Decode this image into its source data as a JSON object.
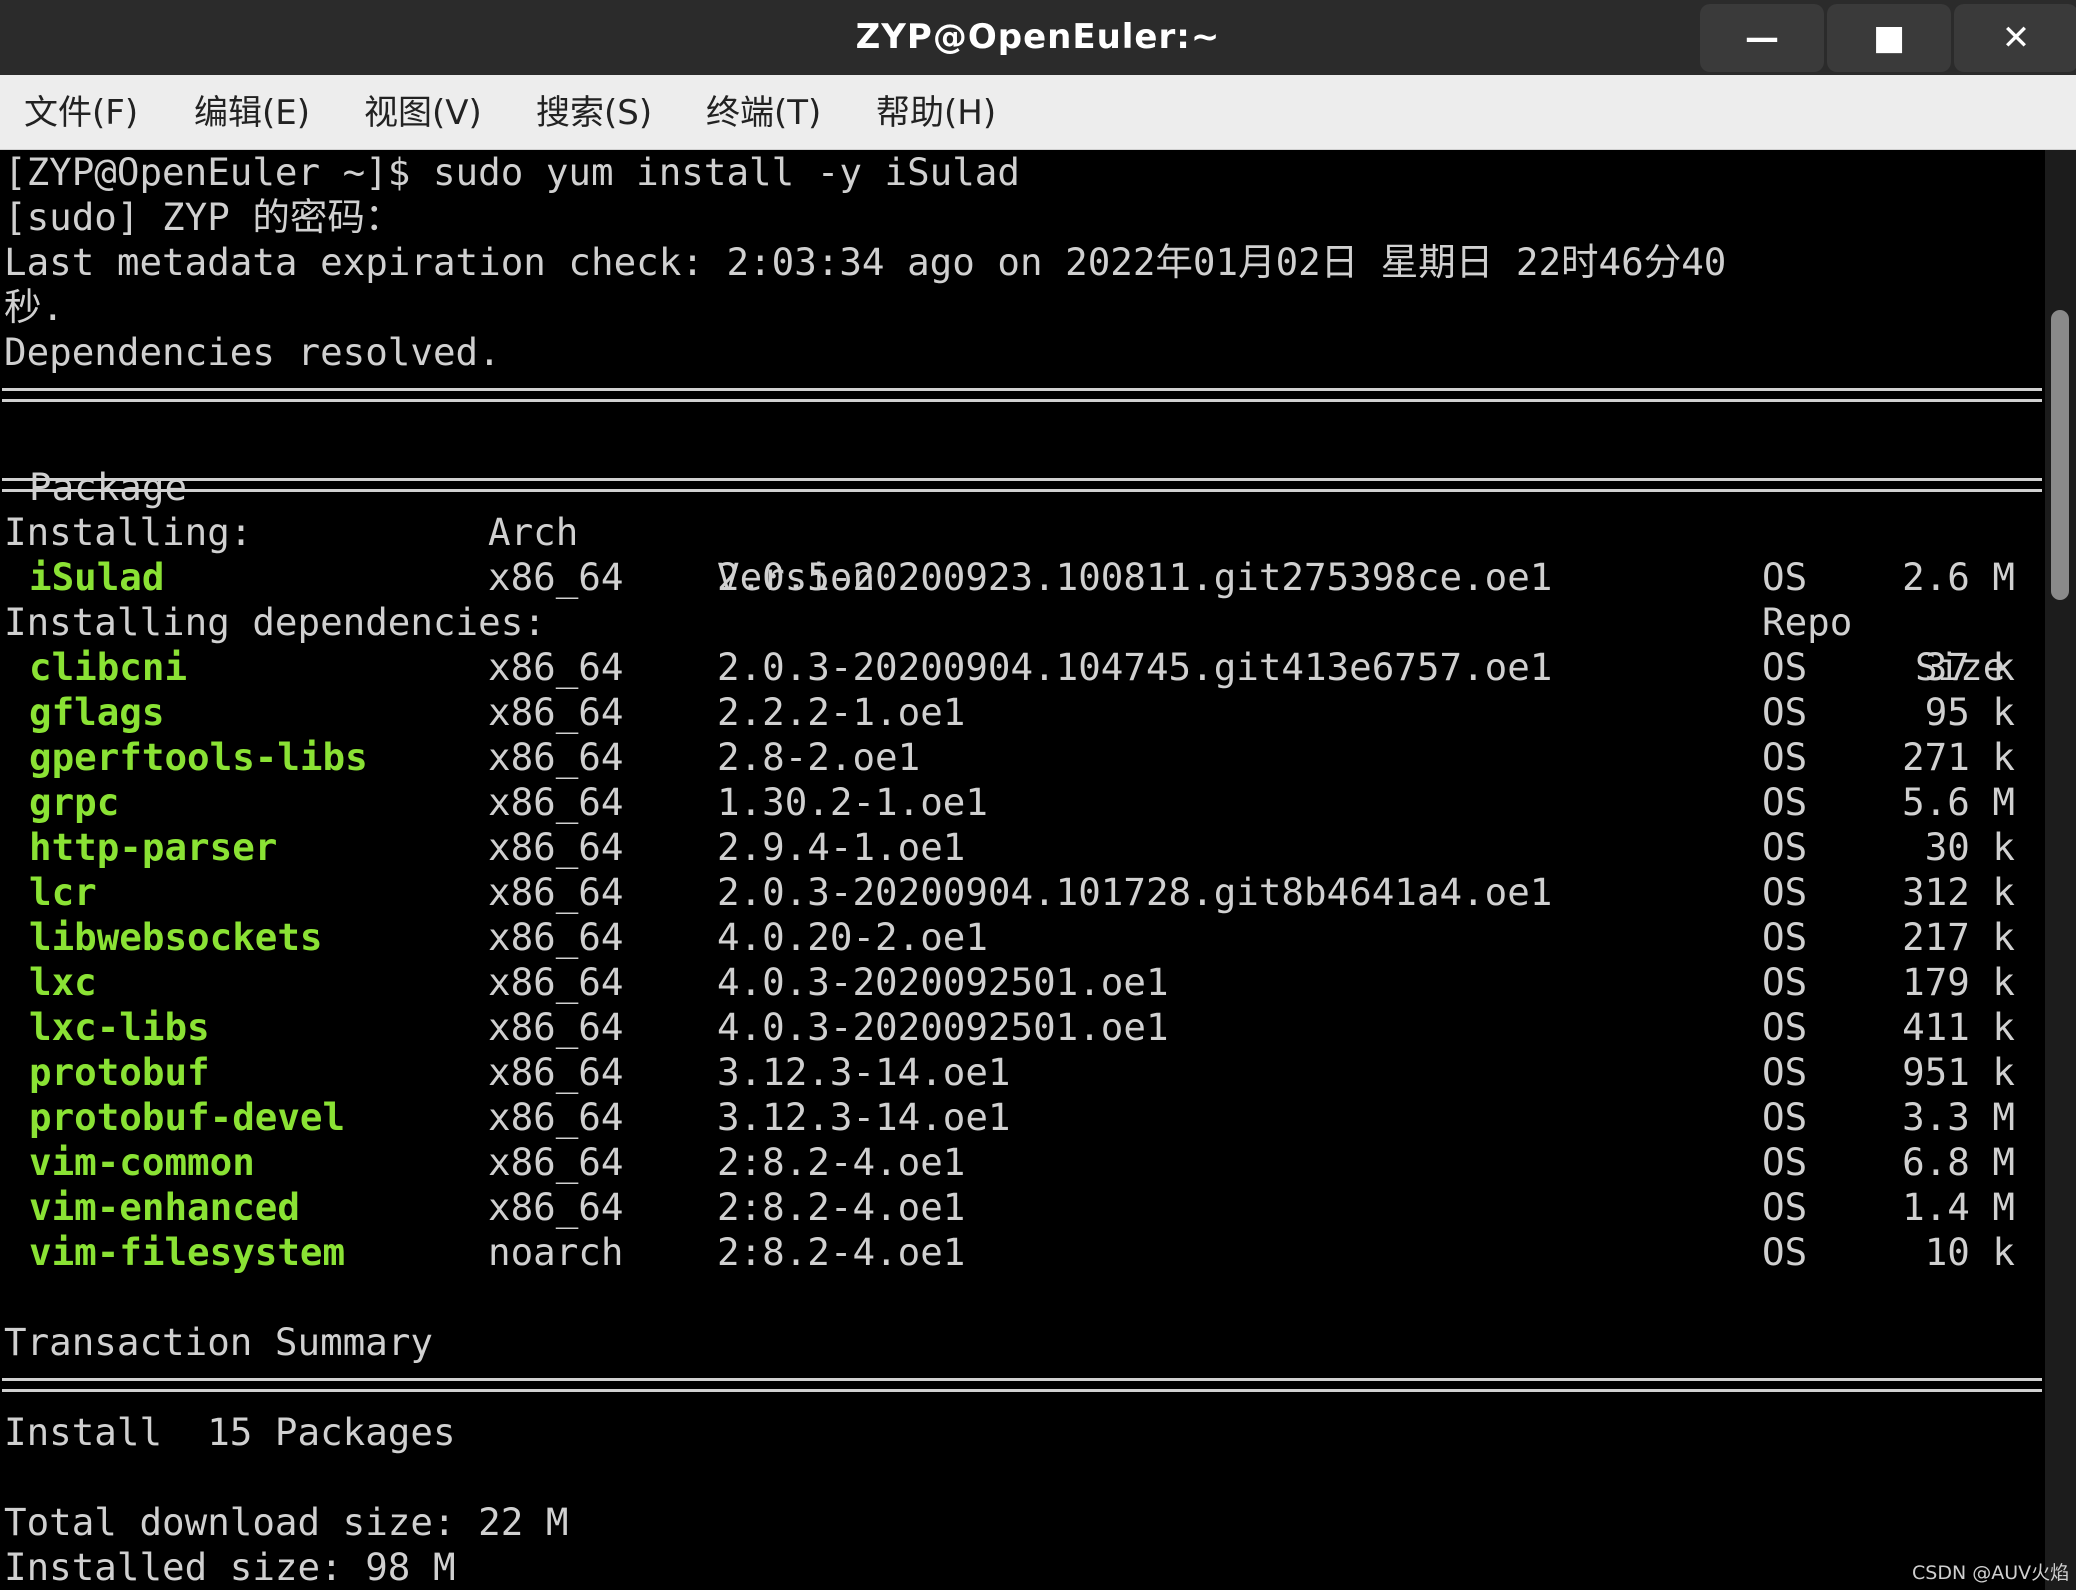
{
  "window": {
    "title": "ZYP@OpenEuler:~",
    "minimize_symbol": "—",
    "maximize_symbol": "■",
    "close_symbol": "✕"
  },
  "menu": [
    "文件(F)",
    "编辑(E)",
    "视图(V)",
    "搜索(S)",
    "终端(T)",
    "帮助(H)"
  ],
  "terminal": {
    "prompt_line": "[ZYP@OpenEuler ~]$ sudo yum install -y iSulad",
    "sudo_line": "[sudo] ZYP 的密码：",
    "metadata_line1": "Last metadata expiration check: 2:03:34 ago on 2022年01月02日 星期日 22时46分40",
    "metadata_line2": "秒.",
    "deps_resolved": "Dependencies resolved.",
    "headers": {
      "package": "Package",
      "arch": "Arch",
      "version": "Version",
      "repo": "Repo",
      "size": "Size"
    },
    "installing_label": "Installing:",
    "installing": [
      {
        "name": "iSulad",
        "arch": "x86_64",
        "version": "2.0.5-20200923.100811.git275398ce.oe1",
        "repo": "OS",
        "size": "2.6 M"
      }
    ],
    "deps_label": "Installing dependencies:",
    "dependencies": [
      {
        "name": "clibcni",
        "arch": "x86_64",
        "version": "2.0.3-20200904.104745.git413e6757.oe1",
        "repo": "OS",
        "size": "37 k"
      },
      {
        "name": "gflags",
        "arch": "x86_64",
        "version": "2.2.2-1.oe1",
        "repo": "OS",
        "size": "95 k"
      },
      {
        "name": "gperftools-libs",
        "arch": "x86_64",
        "version": "2.8-2.oe1",
        "repo": "OS",
        "size": "271 k"
      },
      {
        "name": "grpc",
        "arch": "x86_64",
        "version": "1.30.2-1.oe1",
        "repo": "OS",
        "size": "5.6 M"
      },
      {
        "name": "http-parser",
        "arch": "x86_64",
        "version": "2.9.4-1.oe1",
        "repo": "OS",
        "size": "30 k"
      },
      {
        "name": "lcr",
        "arch": "x86_64",
        "version": "2.0.3-20200904.101728.git8b4641a4.oe1",
        "repo": "OS",
        "size": "312 k"
      },
      {
        "name": "libwebsockets",
        "arch": "x86_64",
        "version": "4.0.20-2.oe1",
        "repo": "OS",
        "size": "217 k"
      },
      {
        "name": "lxc",
        "arch": "x86_64",
        "version": "4.0.3-2020092501.oe1",
        "repo": "OS",
        "size": "179 k"
      },
      {
        "name": "lxc-libs",
        "arch": "x86_64",
        "version": "4.0.3-2020092501.oe1",
        "repo": "OS",
        "size": "411 k"
      },
      {
        "name": "protobuf",
        "arch": "x86_64",
        "version": "3.12.3-14.oe1",
        "repo": "OS",
        "size": "951 k"
      },
      {
        "name": "protobuf-devel",
        "arch": "x86_64",
        "version": "3.12.3-14.oe1",
        "repo": "OS",
        "size": "3.3 M"
      },
      {
        "name": "vim-common",
        "arch": "x86_64",
        "version": "2:8.2-4.oe1",
        "repo": "OS",
        "size": "6.8 M"
      },
      {
        "name": "vim-enhanced",
        "arch": "x86_64",
        "version": "2:8.2-4.oe1",
        "repo": "OS",
        "size": "1.4 M"
      },
      {
        "name": "vim-filesystem",
        "arch": "noarch",
        "version": "2:8.2-4.oe1",
        "repo": "OS",
        "size": "10 k"
      }
    ],
    "summary_label": "Transaction Summary",
    "install_summary": "Install  15 Packages",
    "total_download": "Total download size: 22 M",
    "installed_size": "Installed size: 98 M"
  },
  "watermark": "CSDN @AUV火焰",
  "colors": {
    "package_green": "#8ae234",
    "text": "#d0d0d0",
    "background": "#000000"
  }
}
